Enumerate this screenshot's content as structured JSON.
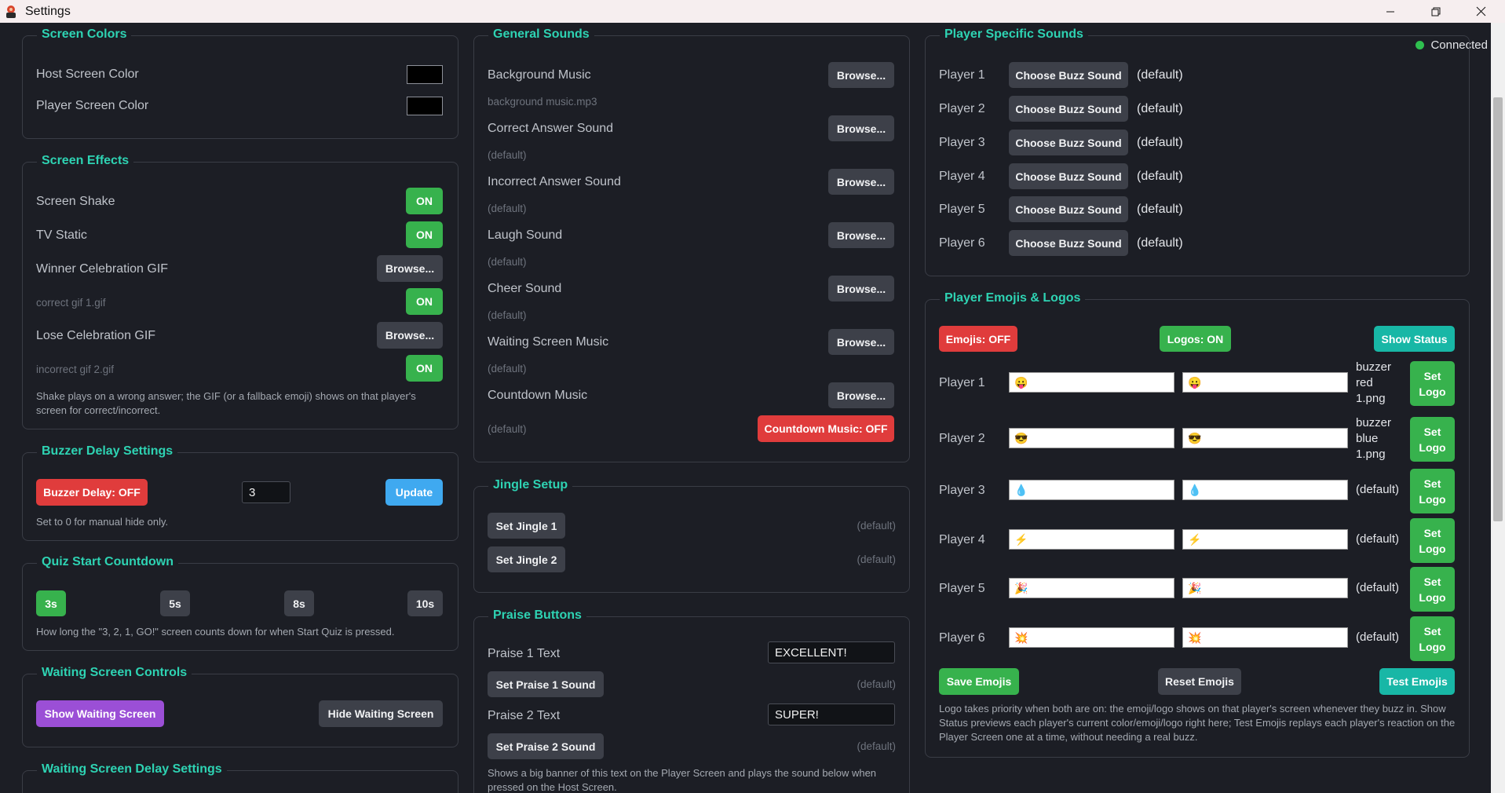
{
  "window": {
    "title": "Settings"
  },
  "status": {
    "label": "Connected",
    "color": "#2fbf4f"
  },
  "colors": {
    "accent": "#2ed3b3",
    "on": "#37b24d",
    "off": "#e03c3c",
    "panel_border": "#3a3d46",
    "background": "#1c1e25"
  },
  "screen_colors": {
    "title": "Screen Colors",
    "host_label": "Host Screen Color",
    "host_color": "#000000",
    "player_label": "Player Screen Color",
    "player_color": "#000000"
  },
  "screen_effects": {
    "title": "Screen Effects",
    "shake_label": "Screen Shake",
    "shake_toggle": "ON",
    "tv_label": "TV Static",
    "tv_toggle": "ON",
    "winner_label": "Winner Celebration GIF",
    "winner_browse": "Browse...",
    "winner_file": "correct gif 1.gif",
    "winner_toggle": "ON",
    "lose_label": "Lose Celebration GIF",
    "lose_browse": "Browse...",
    "lose_file": "incorrect gif 2.gif",
    "lose_toggle": "ON",
    "hint": "Shake plays on a wrong answer; the GIF (or a fallback emoji) shows on that player's screen for correct/incorrect."
  },
  "buzzer_delay": {
    "title": "Buzzer Delay Settings",
    "toggle_label": "Buzzer Delay: OFF",
    "value": "3",
    "update_label": "Update",
    "hint": "Set to 0 for manual hide only."
  },
  "quiz_countdown": {
    "title": "Quiz Start Countdown",
    "options": [
      "3s",
      "5s",
      "8s",
      "10s"
    ],
    "selected": "3s",
    "hint": "How long the \"3, 2, 1, GO!\" screen counts down for when Start Quiz is pressed."
  },
  "waiting_controls": {
    "title": "Waiting Screen Controls",
    "show_label": "Show Waiting Screen",
    "hide_label": "Hide Waiting Screen"
  },
  "waiting_delay": {
    "title": "Waiting Screen Delay Settings"
  },
  "general_sounds": {
    "title": "General Sounds",
    "browse_label": "Browse...",
    "items": [
      {
        "label": "Background Music",
        "file": "background music.mp3"
      },
      {
        "label": "Correct Answer Sound",
        "file": "(default)"
      },
      {
        "label": "Incorrect Answer Sound",
        "file": "(default)"
      },
      {
        "label": "Laugh Sound",
        "file": "(default)"
      },
      {
        "label": "Cheer Sound",
        "file": "(default)"
      },
      {
        "label": "Waiting Screen Music",
        "file": "(default)"
      },
      {
        "label": "Countdown Music",
        "file": "(default)"
      }
    ],
    "countdown_toggle": "Countdown Music: OFF"
  },
  "jingle_setup": {
    "title": "Jingle Setup",
    "jingle1_label": "Set Jingle 1",
    "jingle1_file": "(default)",
    "jingle2_label": "Set Jingle 2",
    "jingle2_file": "(default)"
  },
  "praise_buttons": {
    "title": "Praise Buttons",
    "p1_text_label": "Praise 1 Text",
    "p1_text_value": "EXCELLENT!",
    "p1_sound_label": "Set Praise 1 Sound",
    "p1_sound_file": "(default)",
    "p2_text_label": "Praise 2 Text",
    "p2_text_value": "SUPER!",
    "p2_sound_label": "Set Praise 2 Sound",
    "p2_sound_file": "(default)",
    "hint": "Shows a big banner of this text on the Player Screen and plays the sound below when pressed on the Host Screen."
  },
  "player_sounds": {
    "title": "Player Specific Sounds",
    "choose_label": "Choose Buzz Sound",
    "players": [
      {
        "label": "Player 1",
        "sound": "(default)"
      },
      {
        "label": "Player 2",
        "sound": "(default)"
      },
      {
        "label": "Player 3",
        "sound": "(default)"
      },
      {
        "label": "Player 4",
        "sound": "(default)"
      },
      {
        "label": "Player 5",
        "sound": "(default)"
      },
      {
        "label": "Player 6",
        "sound": "(default)"
      }
    ]
  },
  "emojis_logos": {
    "title": "Player Emojis & Logos",
    "emojis_toggle": "Emojis: OFF",
    "logos_toggle": "Logos: ON",
    "show_status_label": "Show Status",
    "set_logo_label": "Set Logo",
    "players": [
      {
        "label": "Player 1",
        "emoji1": "😛",
        "emoji2": "😛",
        "logo_lines": [
          "buzzer",
          "red",
          "1.png"
        ]
      },
      {
        "label": "Player 2",
        "emoji1": "😎",
        "emoji2": "😎",
        "logo_lines": [
          "buzzer",
          "blue",
          "1.png"
        ]
      },
      {
        "label": "Player 3",
        "emoji1": "💧",
        "emoji2": "💧",
        "logo_lines": [
          "(default)"
        ]
      },
      {
        "label": "Player 4",
        "emoji1": "⚡",
        "emoji2": "⚡",
        "logo_lines": [
          "(default)"
        ]
      },
      {
        "label": "Player 5",
        "emoji1": "🎉",
        "emoji2": "🎉",
        "logo_lines": [
          "(default)"
        ]
      },
      {
        "label": "Player 6",
        "emoji1": "💥",
        "emoji2": "💥",
        "logo_lines": [
          "(default)"
        ]
      }
    ],
    "save_label": "Save Emojis",
    "reset_label": "Reset Emojis",
    "test_label": "Test Emojis",
    "hint": "Logo takes priority when both are on: the emoji/logo shows on that player's screen whenever they buzz in. Show Status previews each player's current color/emoji/logo right here; Test Emojis replays each player's reaction on the Player Screen one at a time, without needing a real buzz."
  }
}
